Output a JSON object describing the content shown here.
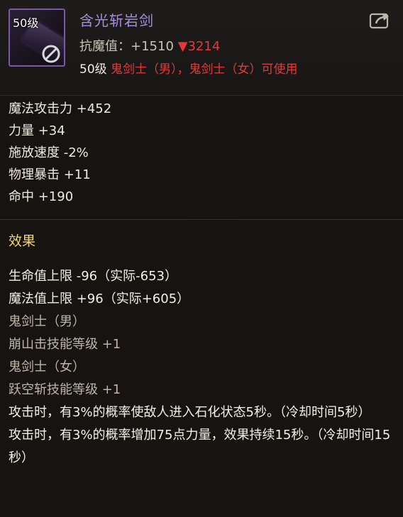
{
  "item": {
    "name": "含光斩岩剑",
    "icon_level": "50级",
    "resist_label": "抗魔值：",
    "resist_value": "+1510",
    "resist_delta": "▼3214",
    "req_level": "50级",
    "req_classes": "鬼剑士（男），鬼剑士（女）可使用"
  },
  "stats": [
    "魔法攻击力 +452",
    "力量 +34",
    "施放速度 -2%",
    "物理暴击 +11",
    "命中 +190"
  ],
  "effect_section": {
    "title": "效果",
    "lines": [
      {
        "text": "生命值上限 -96（实际-653）",
        "style": "strong"
      },
      {
        "text": "魔法值上限 +96（实际+605）",
        "style": "strong"
      },
      {
        "text": "鬼剑士（男）",
        "style": "dim"
      },
      {
        "text": "崩山击技能等级 +1",
        "style": "dim"
      },
      {
        "text": "鬼剑士（女）",
        "style": "dim"
      },
      {
        "text": "跃空斩技能等级 +1",
        "style": "dim"
      },
      {
        "text": "攻击时，有3%的概率使敌人进入石化状态5秒。（冷却时间5秒）",
        "style": "strong"
      },
      {
        "text": "攻击时，有3%的概率增加75点力量，效果持续15秒。（冷却时间15秒）",
        "style": "strong"
      }
    ]
  },
  "colors": {
    "item_name": "#a98de0",
    "negative": "#e23a3a",
    "section_title": "#f0d67a",
    "icon_border": "#7a58a8"
  },
  "icons": {
    "item": "sword-item-icon",
    "restricted": "no-entry-icon",
    "share": "share-icon"
  }
}
